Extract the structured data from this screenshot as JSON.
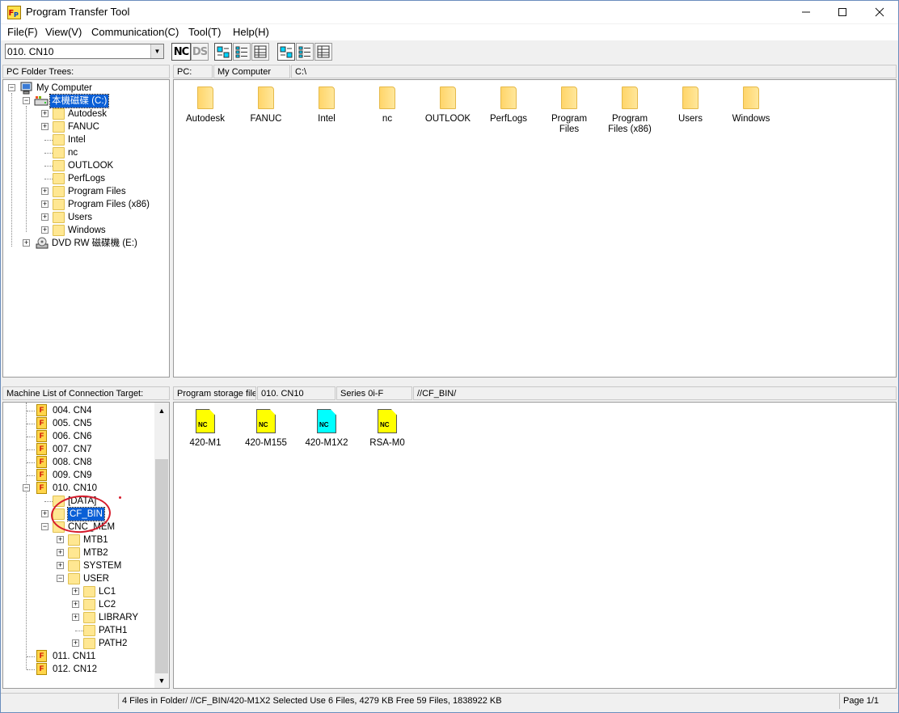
{
  "window": {
    "title": "Program Transfer Tool"
  },
  "menu": [
    "File(F)",
    "View(V)",
    "Communication(C)",
    "Tool(T)",
    "Help(H)"
  ],
  "toolbar": {
    "machine_select": "010. CN10",
    "nc_label": "NC",
    "ds_label": "DS"
  },
  "pc_tree": {
    "header": "PC Folder Trees:",
    "root": "My Computer",
    "drive": "本機磁碟 (C:)",
    "folders": [
      "Autodesk",
      "FANUC",
      "Intel",
      "nc",
      "OUTLOOK",
      "PerfLogs",
      "Program Files",
      "Program Files (x86)",
      "Users",
      "Windows"
    ],
    "dvd": "DVD RW 磁碟機 (E:)"
  },
  "pc_path": {
    "label": "PC:",
    "location": "My Computer",
    "path": "C:\\"
  },
  "pc_files": [
    "Autodesk",
    "FANUC",
    "Intel",
    "nc",
    "OUTLOOK",
    "PerfLogs",
    "Program Files",
    "Program Files (x86)",
    "Users",
    "Windows"
  ],
  "machine_tree": {
    "header": "Machine List of Connection Target:",
    "machines_before": [
      "004. CN4",
      "005. CN5",
      "006. CN6",
      "007. CN7",
      "008. CN8",
      "009. CN9"
    ],
    "current": "010. CN10",
    "data": "[DATA]",
    "cf_bin": "CF_BIN",
    "cnc_mem": "CNC_MEM",
    "mem_children": [
      "MTB1",
      "MTB2",
      "SYSTEM",
      "USER"
    ],
    "user_children": [
      "LC1",
      "LC2",
      "LIBRARY",
      "PATH1",
      "PATH2"
    ],
    "machines_after": [
      "011. CN11",
      "012. CN12"
    ]
  },
  "storage": {
    "label": "Program storage file:",
    "machine": "010. CN10",
    "series": "Series 0i-F",
    "path": "//CF_BIN/"
  },
  "nc_files": [
    {
      "name": "420-M1",
      "color": "#ffff00"
    },
    {
      "name": "420-M155",
      "color": "#ffff00"
    },
    {
      "name": "420-M1X2",
      "color": "#00ffff"
    },
    {
      "name": "RSA-M0",
      "color": "#ffff00"
    }
  ],
  "status": {
    "left": "",
    "main": "4 Files in Folder/  //CF_BIN/420-M1X2 Selected  Use 6 Files, 4279 KB  Free 59 Files, 1838922 KB",
    "page": "Page 1/1"
  }
}
